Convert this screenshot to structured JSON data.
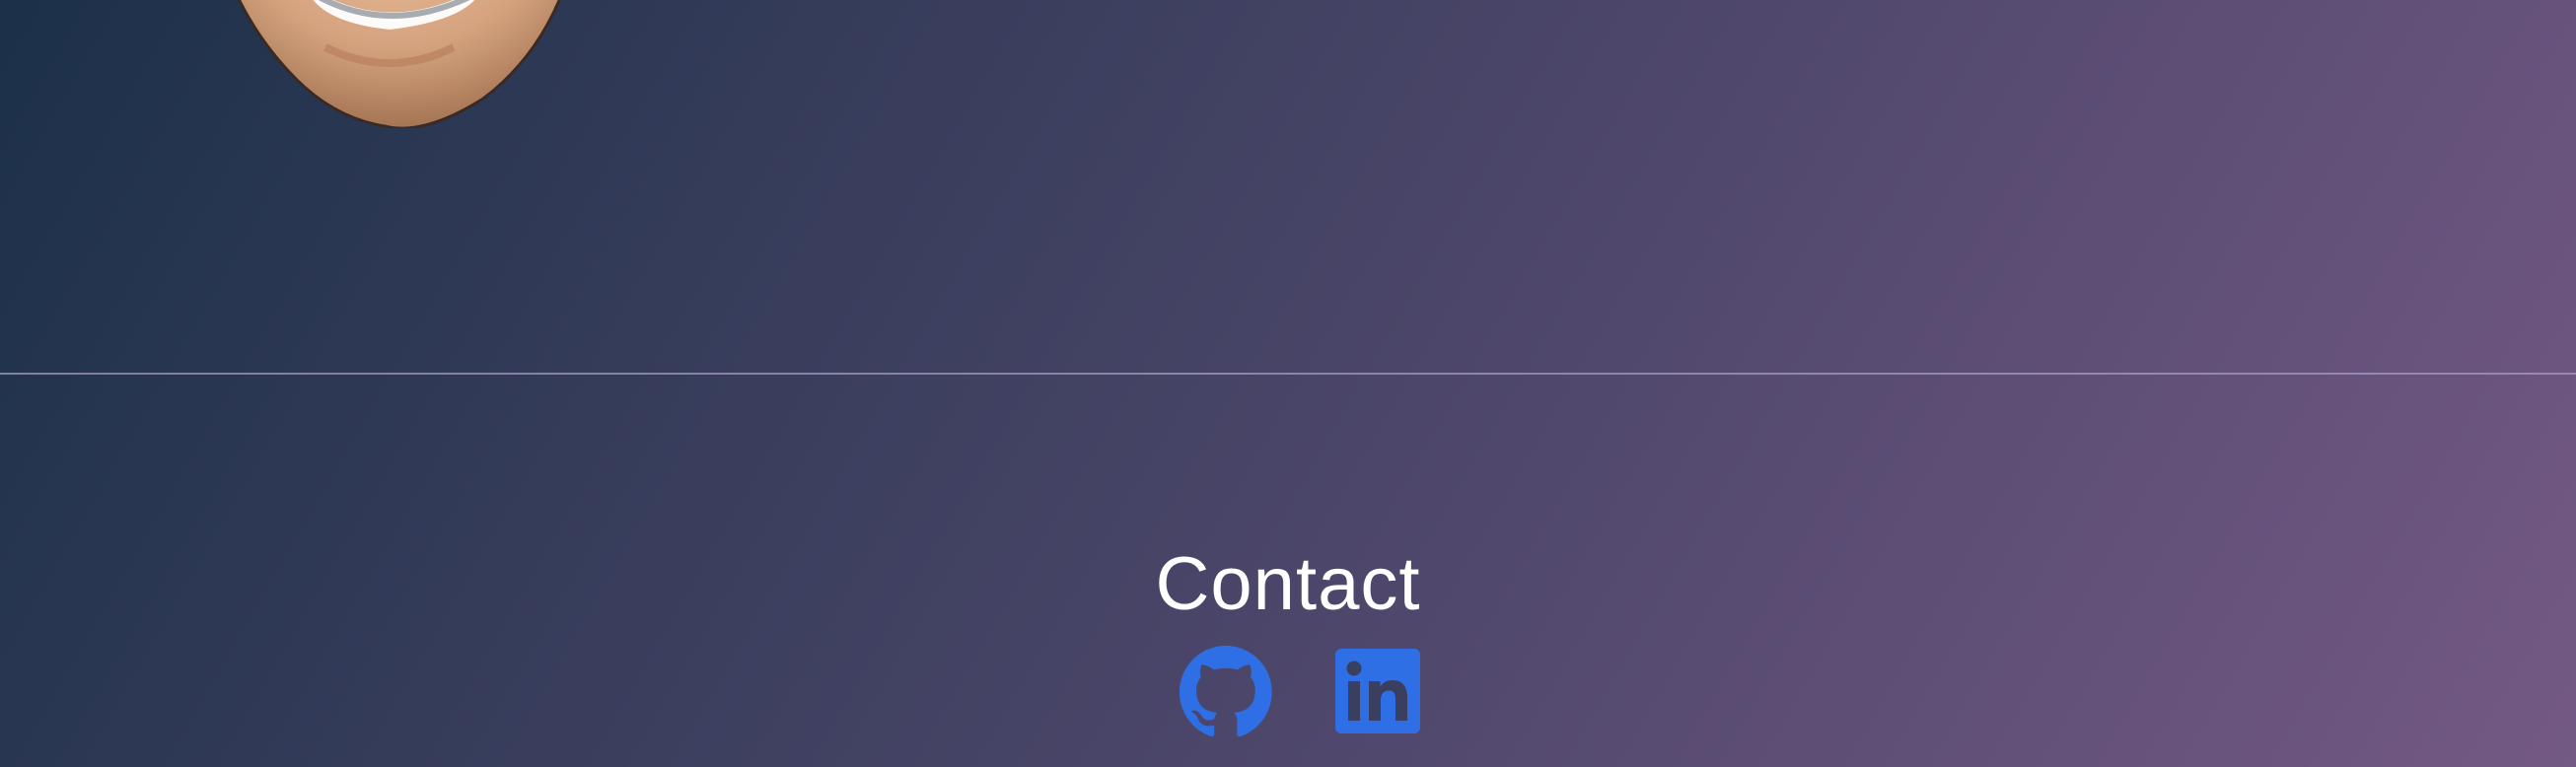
{
  "contact": {
    "title": "Contact"
  },
  "social_links": [
    {
      "name": "github",
      "icon": "github-icon"
    },
    {
      "name": "linkedin",
      "icon": "linkedin-icon"
    }
  ],
  "colors": {
    "icon_accent": "#2f6fe6",
    "divider": "#a9a1c5",
    "text": "#ffffff"
  }
}
